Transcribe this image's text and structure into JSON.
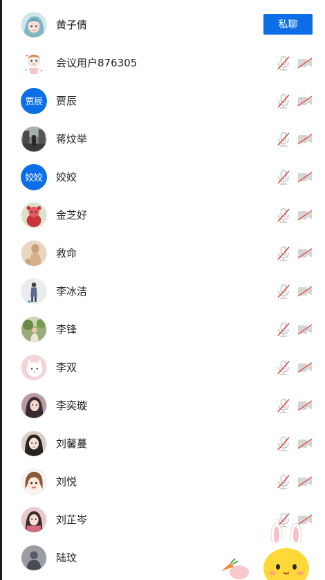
{
  "members": [
    {
      "name": "黄子倩",
      "avatar": "photo",
      "avatar_icon": "cartoon-girl-teal-hair",
      "avatar_bg": "#7fb6c4"
    },
    {
      "name": "会议用户876305",
      "avatar": "photo",
      "avatar_icon": "cartoon-doll",
      "avatar_bg": "#f4eeee"
    },
    {
      "name": "贾辰",
      "avatar": "text",
      "avatar_text": "贾辰"
    },
    {
      "name": "蒋炆举",
      "avatar": "photo",
      "avatar_icon": "street-photo",
      "avatar_bg": "#5a5a5a"
    },
    {
      "name": "姣姣",
      "avatar": "text",
      "avatar_text": "姣姣"
    },
    {
      "name": "金芝好",
      "avatar": "photo",
      "avatar_icon": "red-doll-photo",
      "avatar_bg": "#c94a4f"
    },
    {
      "name": "救命",
      "avatar": "photo",
      "avatar_icon": "beige-figure",
      "avatar_bg": "#d9bea2"
    },
    {
      "name": "李冰洁",
      "avatar": "photo",
      "avatar_icon": "person-standing",
      "avatar_bg": "#e8e8e8"
    },
    {
      "name": "李锋",
      "avatar": "photo",
      "avatar_icon": "outdoor-photo",
      "avatar_bg": "#8a9a6a"
    },
    {
      "name": "李双",
      "avatar": "photo",
      "avatar_icon": "white-cat",
      "avatar_bg": "#f0d4d6"
    },
    {
      "name": "李奕璇",
      "avatar": "photo",
      "avatar_icon": "portrait-dark",
      "avatar_bg": "#6a4a55"
    },
    {
      "name": "刘馨蔓",
      "avatar": "photo",
      "avatar_icon": "portrait-girl",
      "avatar_bg": "#8a7a70"
    },
    {
      "name": "刘悦",
      "avatar": "photo",
      "avatar_icon": "cartoon-face",
      "avatar_bg": "#f3e1d6"
    },
    {
      "name": "刘芷岑",
      "avatar": "photo",
      "avatar_icon": "portrait-pink",
      "avatar_bg": "#b46a78"
    },
    {
      "name": "陆玟",
      "avatar": "photo",
      "avatar_icon": "grey-photo",
      "avatar_bg": "#8a8d94"
    }
  ],
  "private_chat_label": "私聊",
  "colors": {
    "accent": "#0d6fe8",
    "muted_icon": "#c8c8c8",
    "muted_slash": "#e0413a"
  }
}
